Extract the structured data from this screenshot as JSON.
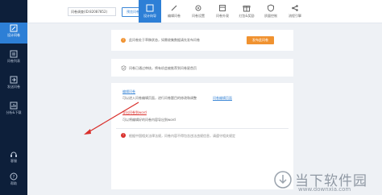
{
  "sidebar": {
    "items": [
      {
        "label": "设计问卷",
        "icon": "edit-icon"
      },
      {
        "label": "问卷列表",
        "icon": "list-icon"
      },
      {
        "label": "发送问卷",
        "icon": "send-icon"
      },
      {
        "label": "分析&下载",
        "icon": "chart-icon"
      },
      {
        "label": "客服",
        "icon": "headset-icon"
      },
      {
        "label": "帮助",
        "icon": "help-icon"
      }
    ]
  },
  "header": {
    "survey_select": "问卷调查(ID:82087852)",
    "preview_label": "预览问卷",
    "tabs": [
      {
        "label": "设计向导",
        "icon": "wizard-icon"
      },
      {
        "label": "编辑问卷",
        "icon": "pencil-icon"
      },
      {
        "label": "问卷设置",
        "icon": "settings-icon"
      },
      {
        "label": "问卷外观",
        "icon": "palette-icon"
      },
      {
        "label": "红包&奖励",
        "icon": "gift-icon"
      },
      {
        "label": "质量控制",
        "icon": "shield-icon"
      },
      {
        "label": "流程引擎",
        "icon": "share-icon"
      }
    ]
  },
  "notice": {
    "text": "此问卷处于草稿状态，如需收集数据请先发布问卷",
    "publish_label": "发布此问卷"
  },
  "verify": {
    "text": "问卷已通过审核，将有机会被推荐到问卷星首页"
  },
  "links": {
    "edit_title": "编辑问卷",
    "edit_desc": "可以进入问卷编辑页面，进行问卷题目的修改和调整",
    "edit_link": "问卷编辑页面",
    "import_title": "导出问卷到word",
    "import_desc": "可以将编辑好的问卷内容导出到word"
  },
  "footer": {
    "notice_text": "根据中国相关法律法规，问卷内容不得包含违法违规信息，请遵守相关规定"
  },
  "watermark": {
    "brand": "当下软件园",
    "url": "www.downxia.com"
  },
  "colors": {
    "accent": "#2d7fd6",
    "sidebar_bg": "#0d1f3a",
    "publish": "#f09230",
    "arrow": "#d9302c"
  }
}
